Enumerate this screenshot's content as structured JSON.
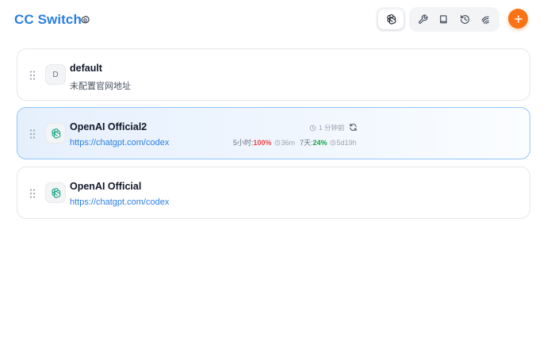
{
  "header": {
    "title": "CC Switch"
  },
  "providers": [
    {
      "name": "default",
      "avatar_letter": "D",
      "subtitle": "未配置官网地址",
      "active": false
    },
    {
      "name": "OpenAI Official2",
      "url": "https://chatgpt.com/codex",
      "active": true,
      "usage": {
        "updated": "1 分钟前",
        "window5h_label": "5小时:",
        "window5h_pct": "100%",
        "window5h_reset": "36m",
        "window7d_label": "7天:",
        "window7d_pct": "24%",
        "window7d_reset": "5d19h"
      }
    },
    {
      "name": "OpenAI Official",
      "url": "https://chatgpt.com/codex",
      "active": false
    }
  ],
  "colors": {
    "accent": "#2b7fe0",
    "add_button": "#f97316",
    "active_border": "#93c5fd",
    "usage_high": "#ef4444",
    "usage_ok": "#16a34a"
  },
  "icons": {
    "settings": "gear-icon",
    "provider": "openai-icon",
    "tools": [
      "wrench-icon",
      "book-icon",
      "history-icon",
      "fingerprint-icon"
    ],
    "add": "plus-icon"
  }
}
